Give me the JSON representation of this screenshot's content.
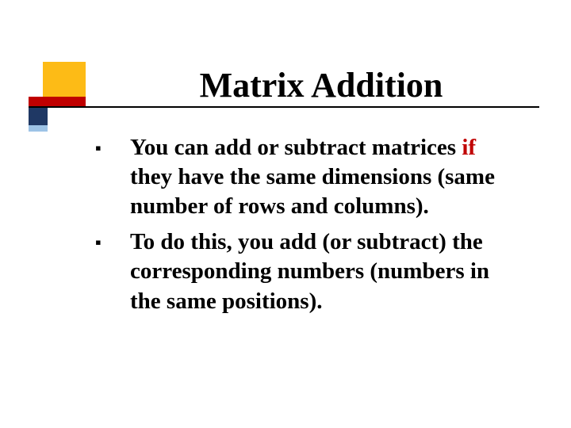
{
  "title": "Matrix Addition",
  "bullets": [
    {
      "prefix": "You can add or subtract matrices ",
      "emph": "if",
      "rest": " they have the same dimensions (same number of rows and columns)."
    },
    {
      "prefix": "To do this, you add (or subtract) the corresponding numbers (numbers in the same positions).",
      "emph": "",
      "rest": ""
    }
  ],
  "colors": {
    "accent_red": "#c00000",
    "accent_yellow": "#fdbb16",
    "accent_dblue": "#1f3864",
    "accent_lblue": "#9dc3e6"
  }
}
